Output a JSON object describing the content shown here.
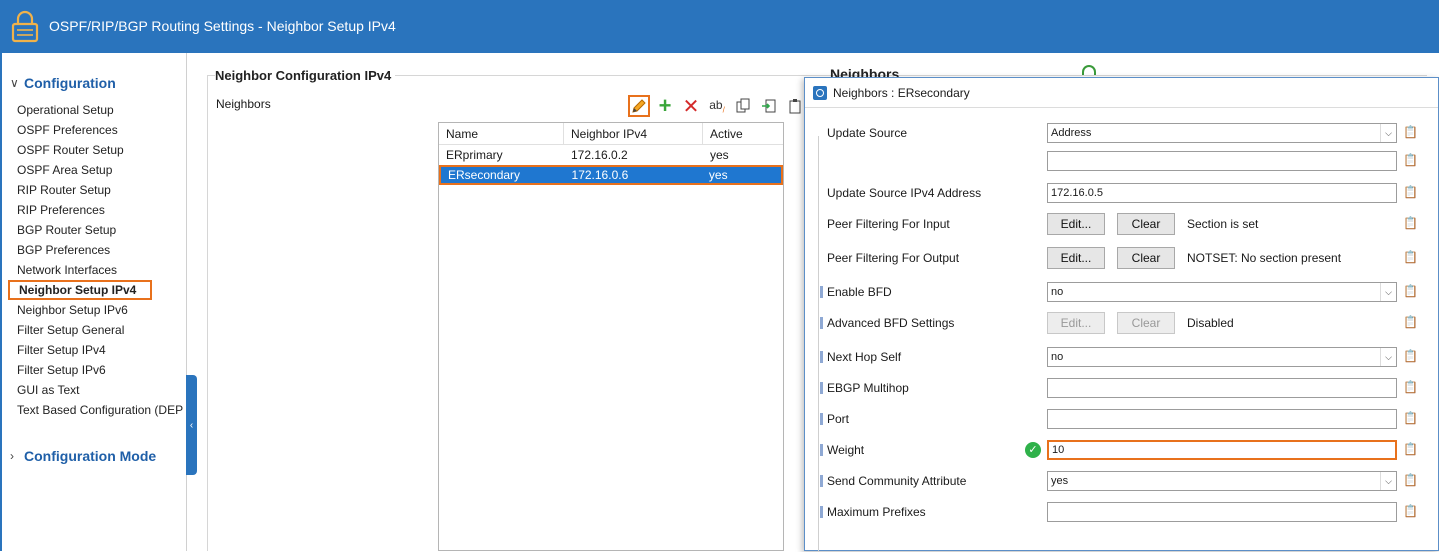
{
  "window": {
    "title": "OSPF/RIP/BGP Routing Settings - Neighbor Setup IPv4"
  },
  "sidebar": {
    "section_config": "Configuration",
    "items": [
      "Operational Setup",
      "OSPF Preferences",
      "OSPF Router Setup",
      "OSPF Area Setup",
      "RIP Router Setup",
      "RIP Preferences",
      "BGP Router Setup",
      "BGP Preferences",
      "Network Interfaces",
      "Neighbor Setup IPv4",
      "Neighbor Setup IPv6",
      "Filter Setup General",
      "Filter Setup IPv4",
      "Filter Setup IPv6",
      "GUI as Text",
      "Text Based Configuration (DEP"
    ],
    "active_item": "Neighbor Setup IPv4",
    "section_mode": "Configuration Mode"
  },
  "main": {
    "group_title": "Neighbor Configuration IPv4",
    "neighbors_label": "Neighbors",
    "behind_title": "Neighbors",
    "table": {
      "columns": [
        "Name",
        "Neighbor IPv4",
        "Active"
      ],
      "rows": [
        {
          "name": "ERprimary",
          "ip": "172.16.0.2",
          "active": "yes"
        },
        {
          "name": "ERsecondary",
          "ip": "172.16.0.6",
          "active": "yes"
        }
      ],
      "selected_row": 1
    }
  },
  "dialog": {
    "title": "Neighbors : ERsecondary",
    "edit_label": "Edit...",
    "clear_label": "Clear",
    "fields": {
      "update_source": {
        "label": "Update Source",
        "value": "Address"
      },
      "update_source_blank": {
        "value": ""
      },
      "update_source_ipv4": {
        "label": "Update Source IPv4 Address",
        "value": "172.16.0.5"
      },
      "peer_filter_input": {
        "label": "Peer Filtering For Input",
        "status": "Section is set"
      },
      "peer_filter_output": {
        "label": "Peer Filtering For Output",
        "status": "NOTSET: No section present"
      },
      "enable_bfd": {
        "label": "Enable BFD",
        "value": "no"
      },
      "advanced_bfd": {
        "label": "Advanced BFD Settings",
        "status": "Disabled"
      },
      "next_hop_self": {
        "label": "Next Hop Self",
        "value": "no"
      },
      "ebgp_multihop": {
        "label": "EBGP Multihop",
        "value": ""
      },
      "port": {
        "label": "Port",
        "value": ""
      },
      "weight": {
        "label": "Weight",
        "value": "10"
      },
      "send_community": {
        "label": "Send Community Attribute",
        "value": "yes"
      },
      "maximum_prefixes": {
        "label": "Maximum Prefixes",
        "value": ""
      }
    }
  },
  "colors": {
    "titlebar": "#2a74bd",
    "accent_orange": "#e8711c",
    "selection_blue": "#1f77d0",
    "nav_heading": "#1f5fa8"
  },
  "icons": [
    "lock-icon",
    "pencil-icon",
    "plus-icon",
    "delete-icon",
    "rename-icon",
    "copy-icon",
    "import-icon",
    "clipboard-icon",
    "check-icon",
    "chevron-down-icon"
  ]
}
